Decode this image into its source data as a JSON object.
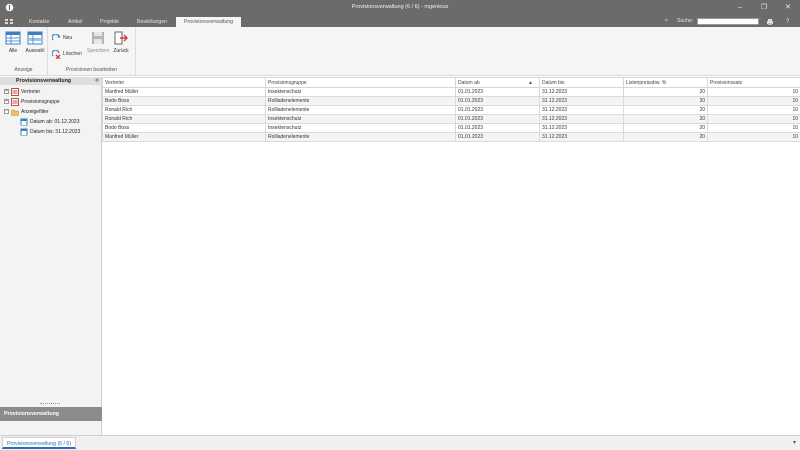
{
  "window": {
    "title": "Provisionsverwaltung (6 / 6) - mgenious",
    "minimize_icon": "–",
    "maximize_icon": "❐",
    "close_icon": "✕"
  },
  "menu": {
    "tabs": [
      {
        "label": "Kontakte"
      },
      {
        "label": "Artikel"
      },
      {
        "label": "Projekte"
      },
      {
        "label": "Bestellungen"
      },
      {
        "label": "Provisionsverwaltung"
      }
    ],
    "search_label": "Suche:",
    "search_value": "",
    "collapse_icon": "^",
    "help_icon": "?"
  },
  "ribbon": {
    "groups": {
      "anzeige": {
        "label": "Anzeige",
        "alle": "Alle",
        "auswahl": "Auswahl"
      },
      "bearbeiten": {
        "label": "Provisionen bearbeiten",
        "neu": "Neu",
        "loeschen": "Löschen",
        "speichern": "Speichern",
        "zurueck": "Zurück"
      }
    }
  },
  "left_panel": {
    "header": "Provisionsverwaltung",
    "collapse_glyph": "«",
    "tree": [
      {
        "label": "Vertreter",
        "expander": "+"
      },
      {
        "label": "Provisionsgruppe",
        "expander": "+"
      },
      {
        "label": "Anzeigefilter",
        "expander": "−"
      },
      {
        "label": "Datum ab: 01.12.2023"
      },
      {
        "label": "Datum bis: 31.12.2023"
      }
    ],
    "footer": "Provisionsverwaltung"
  },
  "grid": {
    "columns": [
      "Vertreter",
      "Provisionsgruppe",
      "Datum ab",
      "Datum bis",
      "Listenpreisabw. %",
      "Provisionssatz"
    ],
    "sort_glyph": "▲",
    "rows": [
      [
        "Manfred Müller",
        "Insektenschutz",
        "01.01.2023",
        "31.12.2023",
        "20",
        "10"
      ],
      [
        "Bodo Boss",
        "Rollladenelemente",
        "01.01.2023",
        "31.12.2023",
        "20",
        "10"
      ],
      [
        "Ronald Rich",
        "Rollladenelemente",
        "01.01.2023",
        "31.12.2023",
        "20",
        "10"
      ],
      [
        "Ronald Rich",
        "Insektenschutz",
        "01.01.2023",
        "31.12.2023",
        "20",
        "10"
      ],
      [
        "Bodo Boss",
        "Insektenschutz",
        "01.01.2023",
        "31.12.2023",
        "20",
        "10"
      ],
      [
        "Manfred Müller",
        "Rollladenelemente",
        "01.01.2023",
        "31.12.2023",
        "20",
        "10"
      ]
    ]
  },
  "bottom": {
    "tab_label": "Provisionsverwaltung (6 / 6)",
    "right_glyph": "▾"
  },
  "colors": {
    "titlebar": "#6b6b6b",
    "accent": "#2a6fb3",
    "ribbon_bg": "#f5f5f5"
  }
}
